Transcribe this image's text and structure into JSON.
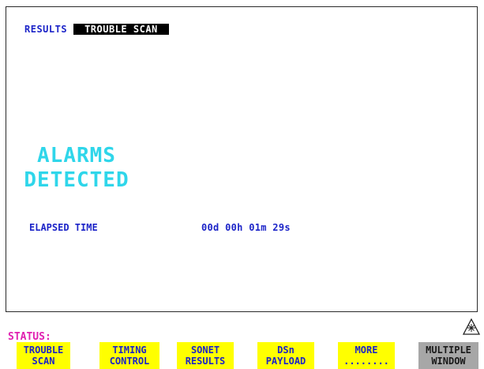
{
  "header": {
    "label": "RESULTS",
    "tab": "TROUBLE SCAN"
  },
  "alarm": {
    "line1": "ALARMS",
    "line2": "DETECTED"
  },
  "elapsed": {
    "label": "ELAPSED TIME",
    "value": "00d 00h 01m 29s"
  },
  "status": {
    "label": "STATUS:"
  },
  "softkeys": [
    {
      "line1": "TROUBLE",
      "line2": "SCAN"
    },
    {
      "line1": "TIMING",
      "line2": "CONTROL"
    },
    {
      "line1": "SONET",
      "line2": "RESULTS"
    },
    {
      "line1": "DSn",
      "line2": "PAYLOAD"
    },
    {
      "line1": "MORE",
      "line2": "........"
    },
    {
      "line1": "MULTIPLE",
      "line2": "WINDOW"
    }
  ],
  "icons": {
    "warning": "laser-warning-icon"
  },
  "colors": {
    "text_blue": "#1c24c8",
    "alarm_cyan": "#2fd6ea",
    "softkey_yellow": "#ffff00",
    "status_magenta": "#e020b0",
    "disabled_grey": "#a7a7a7"
  }
}
